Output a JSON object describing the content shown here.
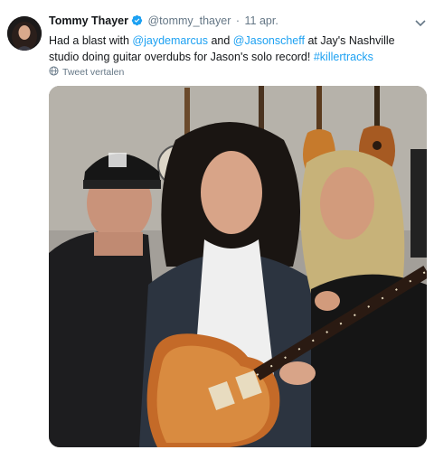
{
  "tweet": {
    "author": {
      "display_name": "Tommy Thayer",
      "handle": "@tommy_thayer",
      "verified": true
    },
    "separator": "·",
    "date": "11 apr.",
    "text_parts": {
      "p1": "Had a blast with ",
      "mention1": "@jaydemarcus",
      "p2": " and ",
      "mention2": "@Jasonscheff",
      "p3": " at Jay's Nashville studio doing guitar overdubs for Jason's solo record! ",
      "hashtag": "#killertracks"
    },
    "translate_label": "Tweet vertalen",
    "icons": {
      "verified": "verified-badge-icon",
      "menu": "chevron-down-icon",
      "translate": "globe-icon"
    }
  },
  "colors": {
    "link": "#1da1f2",
    "secondary_text": "#657786",
    "verified": "#1da1f2"
  }
}
